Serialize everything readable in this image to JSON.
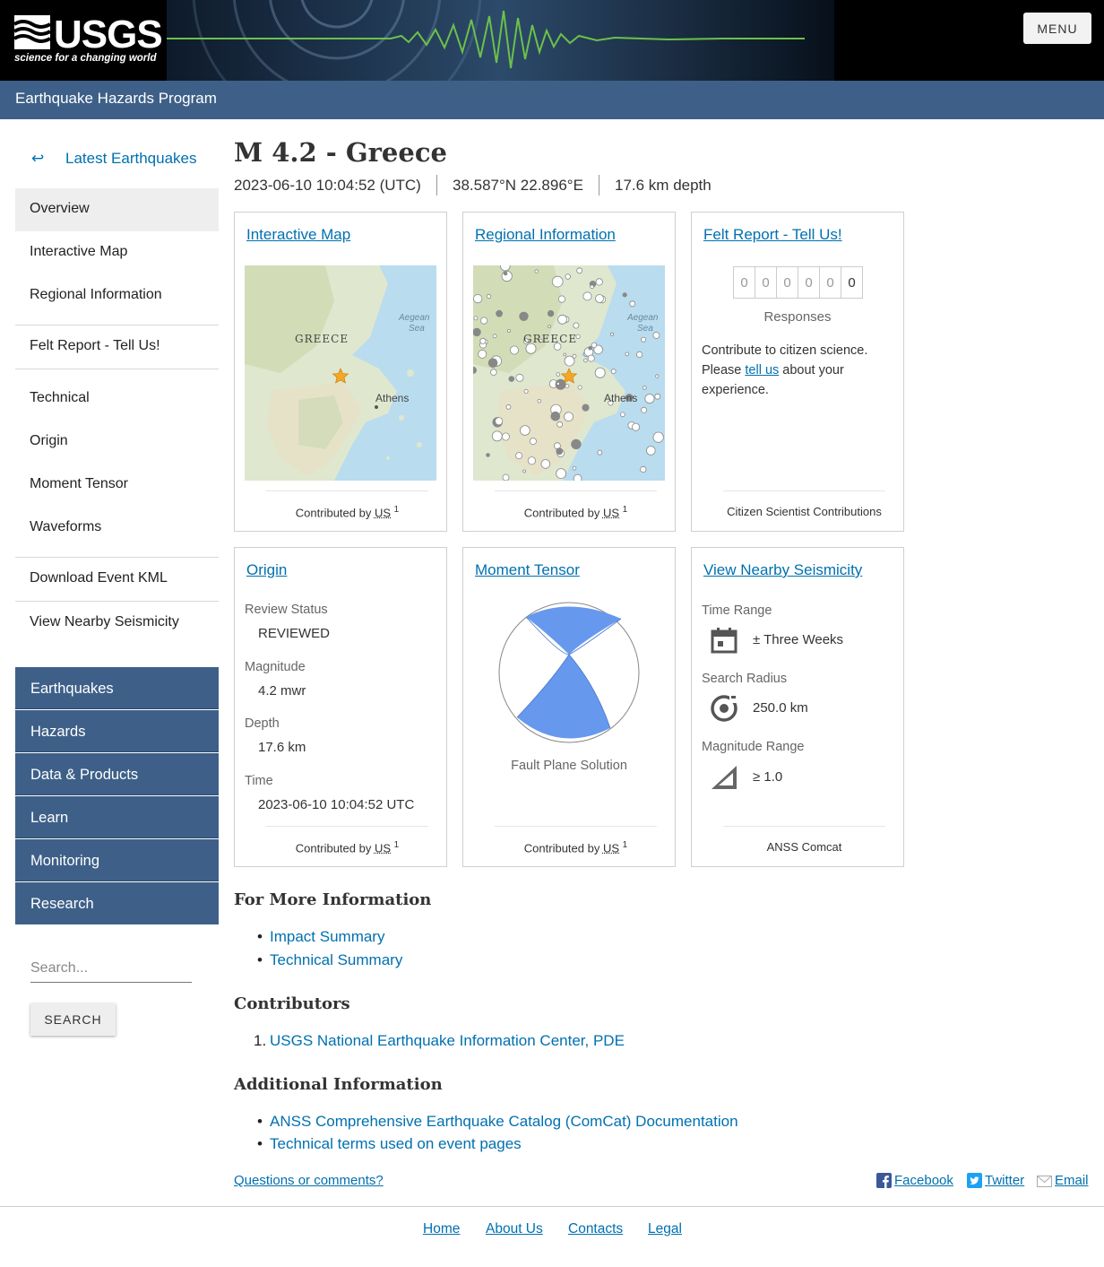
{
  "header": {
    "logo_text": "USGS",
    "logo_tagline": "science for a changing world",
    "menu_label": "MENU",
    "program_title": "Earthquake Hazards Program"
  },
  "sidebar": {
    "back_label": "Latest Earthquakes",
    "back_arrow": "↩",
    "items": [
      "Overview",
      "Interactive Map",
      "Regional Information",
      "Felt Report - Tell Us!",
      "Technical",
      "Origin",
      "Moment Tensor",
      "Waveforms",
      "Download Event KML",
      "View Nearby Seismicity"
    ],
    "active_item": "Overview",
    "nav": [
      "Earthquakes",
      "Hazards",
      "Data & Products",
      "Learn",
      "Monitoring",
      "Research"
    ],
    "search_placeholder": "Search...",
    "search_button": "SEARCH"
  },
  "event": {
    "title": "M 4.2 - Greece",
    "time": "2023-06-10 10:04:52 (UTC)",
    "location": "38.587°N 22.896°E",
    "depth": "17.6 km depth"
  },
  "cards": {
    "interactive_map": {
      "title": "Interactive Map",
      "contributed_prefix": "Contributed by",
      "contributor": "US",
      "contributor_ref": "1",
      "map_labels": {
        "country": "GREECE",
        "sea": "Aegean",
        "sea2": "Sea",
        "city": "Athens"
      }
    },
    "regional": {
      "title": "Regional Information",
      "contributed_prefix": "Contributed by",
      "contributor": "US",
      "contributor_ref": "1",
      "map_labels": {
        "country": "GREECE",
        "sea": "Aegean",
        "sea2": "Sea",
        "city": "Athens"
      }
    },
    "felt": {
      "title": "Felt Report - Tell Us!",
      "digits": [
        "0",
        "0",
        "0",
        "0",
        "0",
        "0"
      ],
      "responses_label": "Responses",
      "text_before": "Contribute to citizen science. Please",
      "link_text": "tell us",
      "text_after": "about your experience.",
      "footer": "Citizen Scientist Contributions"
    },
    "origin": {
      "title": "Origin",
      "review_status_label": "Review Status",
      "review_status": "REVIEWED",
      "magnitude_label": "Magnitude",
      "magnitude": "4.2 mwr",
      "depth_label": "Depth",
      "depth": "17.6 km",
      "time_label": "Time",
      "time": "2023-06-10 10:04:52 UTC",
      "contributed_prefix": "Contributed by",
      "contributor": "US",
      "contributor_ref": "1"
    },
    "moment_tensor": {
      "title": "Moment Tensor",
      "caption": "Fault Plane Solution",
      "contributed_prefix": "Contributed by",
      "contributor": "US",
      "contributor_ref": "1",
      "fill_color": "#6699ee"
    },
    "nearby": {
      "title": "View Nearby Seismicity",
      "time_range_label": "Time Range",
      "time_range": "± Three Weeks",
      "radius_label": "Search Radius",
      "radius": "250.0 km",
      "magnitude_label": "Magnitude Range",
      "magnitude": "≥ 1.0",
      "footer": "ANSS Comcat",
      "icons": [
        "calendar-icon",
        "radius-target-icon",
        "magnitude-ramp-icon"
      ]
    }
  },
  "more_info": {
    "heading": "For More Information",
    "links": [
      "Impact Summary",
      "Technical Summary"
    ]
  },
  "contributors": {
    "heading": "Contributors",
    "number": "1.",
    "items": [
      "USGS National Earthquake Information Center, PDE"
    ]
  },
  "additional": {
    "heading": "Additional Information",
    "links": [
      "ANSS Comprehensive Earthquake Catalog (ComCat) Documentation",
      "Technical terms used on event pages"
    ]
  },
  "bottom": {
    "questions": "Questions or comments?",
    "facebook": "Facebook",
    "twitter": "Twitter",
    "email": "Email"
  },
  "footer": {
    "links": [
      "Home",
      "About Us",
      "Contacts",
      "Legal"
    ]
  },
  "colors": {
    "header_bar": "#3e6088",
    "link": "#0070b0",
    "star": "#f5a623"
  }
}
